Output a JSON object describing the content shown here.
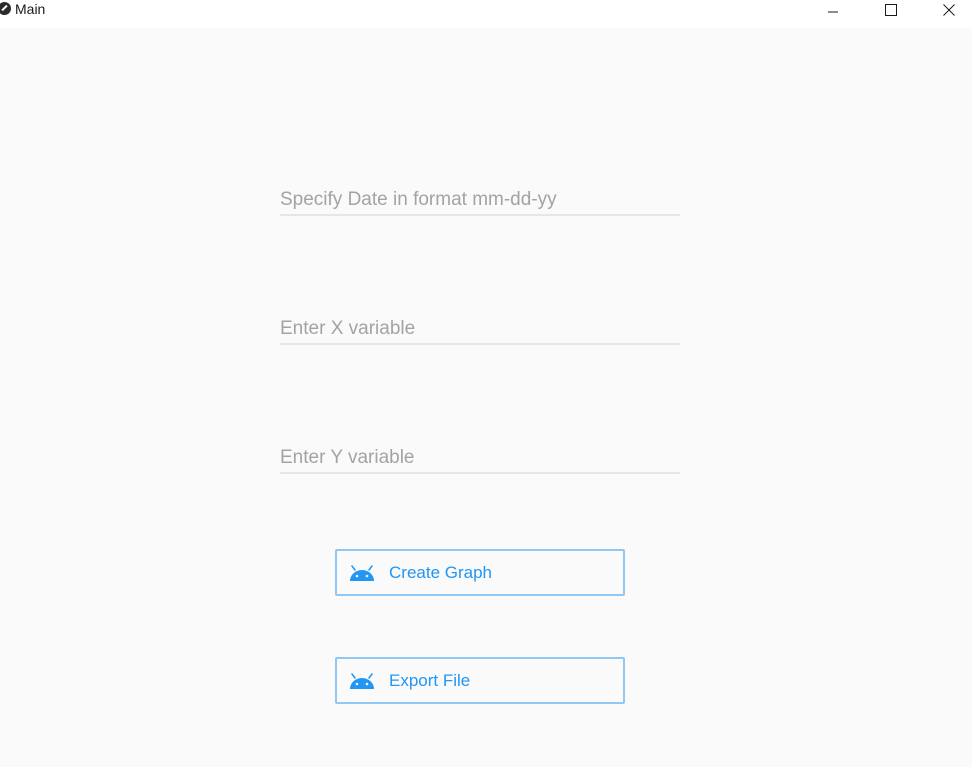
{
  "window": {
    "title": "Main",
    "controls": {
      "minimize_icon": "minimize-icon",
      "maximize_icon": "maximize-icon",
      "close_icon": "close-icon"
    }
  },
  "form": {
    "date_field": {
      "value": "",
      "placeholder": "Specify Date in format mm-dd-yy"
    },
    "x_field": {
      "value": "",
      "placeholder": "Enter X variable"
    },
    "y_field": {
      "value": "",
      "placeholder": "Enter Y variable"
    }
  },
  "buttons": {
    "create_graph": {
      "label": "Create Graph",
      "icon": "android-icon"
    },
    "export_file": {
      "label": "Export File",
      "icon": "android-icon"
    }
  },
  "colors": {
    "accent": "#2196f3",
    "button_border": "#90c8f3",
    "placeholder": "#a3a3a3",
    "background": "#fafafa"
  }
}
